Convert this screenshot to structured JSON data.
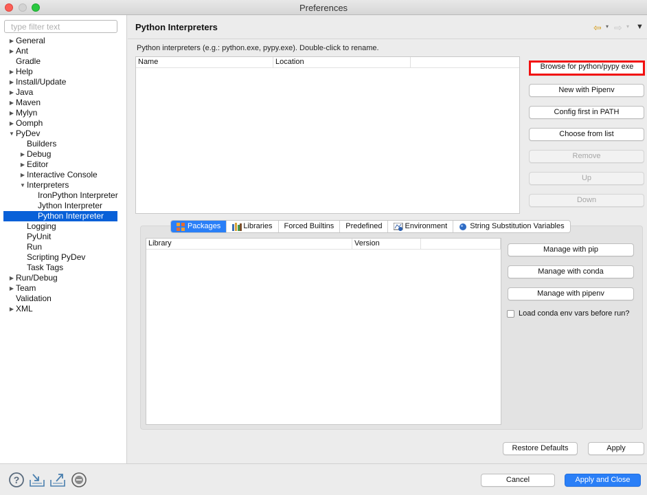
{
  "window": {
    "title": "Preferences"
  },
  "filter": {
    "placeholder": "type filter text"
  },
  "tree": [
    {
      "label": "General",
      "indent": 0,
      "arrow": "right"
    },
    {
      "label": "Ant",
      "indent": 0,
      "arrow": "right"
    },
    {
      "label": "Gradle",
      "indent": 0,
      "arrow": ""
    },
    {
      "label": "Help",
      "indent": 0,
      "arrow": "right"
    },
    {
      "label": "Install/Update",
      "indent": 0,
      "arrow": "right"
    },
    {
      "label": "Java",
      "indent": 0,
      "arrow": "right"
    },
    {
      "label": "Maven",
      "indent": 0,
      "arrow": "right"
    },
    {
      "label": "Mylyn",
      "indent": 0,
      "arrow": "right"
    },
    {
      "label": "Oomph",
      "indent": 0,
      "arrow": "right"
    },
    {
      "label": "PyDev",
      "indent": 0,
      "arrow": "down"
    },
    {
      "label": "Builders",
      "indent": 1,
      "arrow": ""
    },
    {
      "label": "Debug",
      "indent": 1,
      "arrow": "right"
    },
    {
      "label": "Editor",
      "indent": 1,
      "arrow": "right"
    },
    {
      "label": "Interactive Console",
      "indent": 1,
      "arrow": "right"
    },
    {
      "label": "Interpreters",
      "indent": 1,
      "arrow": "down"
    },
    {
      "label": "IronPython Interpreter",
      "indent": 2,
      "arrow": ""
    },
    {
      "label": "Jython Interpreter",
      "indent": 2,
      "arrow": ""
    },
    {
      "label": "Python Interpreter",
      "indent": 2,
      "arrow": "",
      "selected": true
    },
    {
      "label": "Logging",
      "indent": 1,
      "arrow": ""
    },
    {
      "label": "PyUnit",
      "indent": 1,
      "arrow": ""
    },
    {
      "label": "Run",
      "indent": 1,
      "arrow": ""
    },
    {
      "label": "Scripting PyDev",
      "indent": 1,
      "arrow": ""
    },
    {
      "label": "Task Tags",
      "indent": 1,
      "arrow": ""
    },
    {
      "label": "Run/Debug",
      "indent": 0,
      "arrow": "right"
    },
    {
      "label": "Team",
      "indent": 0,
      "arrow": "right"
    },
    {
      "label": "Validation",
      "indent": 0,
      "arrow": ""
    },
    {
      "label": "XML",
      "indent": 0,
      "arrow": "right"
    }
  ],
  "page": {
    "title": "Python Interpreters",
    "hint": "Python interpreters (e.g.: python.exe, pypy.exe).   Double-click to rename."
  },
  "interpreters_table": {
    "columns": [
      "Name",
      "Location",
      ""
    ]
  },
  "interpreter_buttons": {
    "browse": "Browse for python/pypy exe",
    "pipenv": "New with Pipenv",
    "config_path": "Config first in PATH",
    "choose_list": "Choose from list",
    "remove": "Remove",
    "up": "Up",
    "down": "Down"
  },
  "tabs": [
    {
      "label": "Packages",
      "icon": "packages-icon",
      "active": true
    },
    {
      "label": "Libraries",
      "icon": "libraries-icon"
    },
    {
      "label": "Forced Builtins"
    },
    {
      "label": "Predefined"
    },
    {
      "label": "Environment",
      "icon": "environment-icon"
    },
    {
      "label": "String Substitution Variables",
      "icon": "variables-icon"
    }
  ],
  "packages_table": {
    "columns": [
      "Library",
      "Version",
      ""
    ]
  },
  "package_buttons": {
    "pip": "Manage with pip",
    "conda": "Manage with conda",
    "pipenv": "Manage with pipenv"
  },
  "conda_checkbox": {
    "label": "Load conda env vars before run?",
    "checked": false
  },
  "footer": {
    "restore": "Restore Defaults",
    "apply": "Apply",
    "cancel": "Cancel",
    "apply_close": "Apply and Close"
  },
  "colors": {
    "accent": "#2a7ff7",
    "selection": "#0860d8",
    "highlight_border": "#f20f0f"
  }
}
